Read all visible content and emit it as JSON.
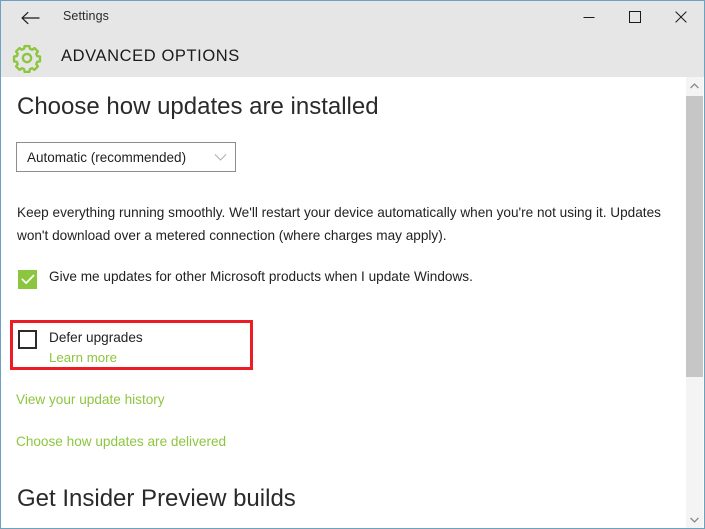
{
  "window": {
    "title": "Settings",
    "back_icon": "back-arrow-icon",
    "controls": {
      "minimize": "minimize-icon",
      "maximize": "maximize-icon",
      "close": "close-icon"
    },
    "border_color": "#6ba3bf",
    "titlebar_color": "#e6e6e6"
  },
  "header": {
    "icon": "gear-icon",
    "icon_color": "#8cc63f",
    "title": "ADVANCED OPTIONS"
  },
  "main": {
    "section_title": "Choose how updates are installed",
    "dropdown": {
      "name": "install-updates-dropdown",
      "value": "Automatic (recommended)",
      "chevron_icon": "chevron-down-icon"
    },
    "description": "Keep everything running smoothly. We'll restart your device automatically when you're not using it. Updates won't download over a metered connection (where charges may apply).",
    "checkboxes": [
      {
        "name": "microsoft-products-checkbox",
        "label": "Give me updates for other Microsoft products when I update Windows.",
        "checked": true,
        "check_icon": "checkmark-icon"
      },
      {
        "name": "defer-upgrades-checkbox",
        "label": "Defer upgrades",
        "checked": false,
        "sub_link": "Learn more"
      }
    ],
    "links": [
      {
        "name": "view-update-history-link",
        "label": "View your update history"
      },
      {
        "name": "choose-delivery-link",
        "label": "Choose how updates are delivered"
      }
    ],
    "second_section_title": "Get Insider Preview builds"
  },
  "annotation": {
    "name": "defer-upgrades-highlight",
    "color": "#ed1c24",
    "border_width": "3px"
  },
  "scrollbar": {
    "up_arrow_icon": "scroll-up-icon",
    "down_arrow_icon": "scroll-down-icon",
    "thumb_color": "#c6c6c6",
    "track_color": "#f4f4f4"
  },
  "colors": {
    "accent_green": "#8cc63f",
    "text": "#222222",
    "annotation_red": "#ed1c24"
  }
}
